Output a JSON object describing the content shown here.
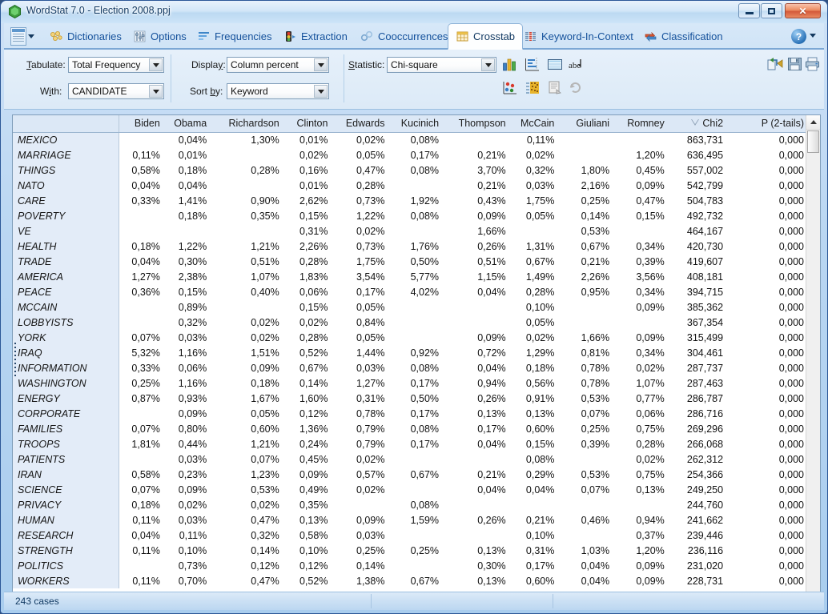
{
  "window": {
    "title": "WordStat 7.0 - Election 2008.ppj",
    "app_icon": "wordstat-logo-icon",
    "controls": {
      "minimize": "minimize-button",
      "maximize": "maximize-button",
      "close": "close-button",
      "close_glyph": "✕"
    }
  },
  "ribbon": {
    "app_menu_label": "application-menu",
    "tabs": [
      {
        "label": "Dictionaries",
        "icon": "dictionaries-icon",
        "active": false
      },
      {
        "label": "Options",
        "icon": "options-icon",
        "active": false
      },
      {
        "label": "Frequencies",
        "icon": "frequencies-icon",
        "active": false
      },
      {
        "label": "Extraction",
        "icon": "extraction-icon",
        "active": false
      },
      {
        "label": "Cooccurrences",
        "icon": "cooccurrences-icon",
        "active": false
      },
      {
        "label": "Crosstab",
        "icon": "crosstab-icon",
        "active": true
      },
      {
        "label": "Keyword-In-Context",
        "icon": "keyword-in-context-icon",
        "active": false
      },
      {
        "label": "Classification",
        "icon": "classification-icon",
        "active": false
      }
    ],
    "help_glyph": "?"
  },
  "options": {
    "tabulate": {
      "label": "Tabulate:",
      "accel": "T",
      "value": "Total Frequency"
    },
    "with": {
      "label": "With:",
      "accel": "i",
      "value": "CANDIDATE"
    },
    "display": {
      "label": "Display:",
      "accel": "y",
      "value": "Column percent"
    },
    "sort_by": {
      "label": "Sort by:",
      "accel": "b",
      "value": "Keyword"
    },
    "statistic": {
      "label": "Statistic:",
      "accel": "S",
      "value": "Chi-square"
    },
    "tool_icons": [
      "bar-chart-icon",
      "dendrogram-icon",
      "table-view-icon",
      "text-sort-icon",
      "scatterplot-icon",
      "heatmap-icon",
      "report-icon",
      "refresh-icon"
    ],
    "right_icons": [
      "export-icon",
      "save-icon",
      "print-icon"
    ]
  },
  "grid": {
    "sort_column": "Romney",
    "sort_indicator": "descending-sort-icon",
    "columns": [
      "",
      "Biden",
      "Obama",
      "Richardson",
      "Clinton",
      "Edwards",
      "Kucinich",
      "Thompson",
      "McCain",
      "Giuliani",
      "Romney",
      "Chi2",
      "P (2-tails)"
    ],
    "rows": [
      {
        "keyword": "MEXICO",
        "values": [
          "",
          "0,04%",
          "1,30%",
          "0,01%",
          "0,02%",
          "0,08%",
          "",
          "0,11%",
          "",
          "",
          "863,731",
          "0,000"
        ],
        "selected": false
      },
      {
        "keyword": "MARRIAGE",
        "values": [
          "0,11%",
          "0,01%",
          "",
          "0,02%",
          "0,05%",
          "0,17%",
          "0,21%",
          "0,02%",
          "",
          "1,20%",
          "636,495",
          "0,000"
        ],
        "selected": false
      },
      {
        "keyword": "THINGS",
        "values": [
          "0,58%",
          "0,18%",
          "0,28%",
          "0,16%",
          "0,47%",
          "0,08%",
          "3,70%",
          "0,32%",
          "1,80%",
          "0,45%",
          "557,002",
          "0,000"
        ],
        "selected": false
      },
      {
        "keyword": "NATO",
        "values": [
          "0,04%",
          "0,04%",
          "",
          "0,01%",
          "0,28%",
          "",
          "0,21%",
          "0,03%",
          "2,16%",
          "0,09%",
          "542,799",
          "0,000"
        ],
        "selected": false
      },
      {
        "keyword": "CARE",
        "values": [
          "0,33%",
          "1,41%",
          "0,90%",
          "2,62%",
          "0,73%",
          "1,92%",
          "0,43%",
          "1,75%",
          "0,25%",
          "0,47%",
          "504,783",
          "0,000"
        ],
        "selected": false
      },
      {
        "keyword": "POVERTY",
        "values": [
          "",
          "0,18%",
          "0,35%",
          "0,15%",
          "1,22%",
          "0,08%",
          "0,09%",
          "0,05%",
          "0,14%",
          "0,15%",
          "492,732",
          "0,000"
        ],
        "selected": true
      },
      {
        "keyword": "VE",
        "values": [
          "",
          "",
          "",
          "0,31%",
          "0,02%",
          "",
          "1,66%",
          "",
          "0,53%",
          "",
          "464,167",
          "0,000"
        ],
        "selected": false
      },
      {
        "keyword": "HEALTH",
        "values": [
          "0,18%",
          "1,22%",
          "1,21%",
          "2,26%",
          "0,73%",
          "1,76%",
          "0,26%",
          "1,31%",
          "0,67%",
          "0,34%",
          "420,730",
          "0,000"
        ],
        "selected": false
      },
      {
        "keyword": "TRADE",
        "values": [
          "0,04%",
          "0,30%",
          "0,51%",
          "0,28%",
          "1,75%",
          "0,50%",
          "0,51%",
          "0,67%",
          "0,21%",
          "0,39%",
          "419,607",
          "0,000"
        ],
        "selected": false
      },
      {
        "keyword": "AMERICA",
        "values": [
          "1,27%",
          "2,38%",
          "1,07%",
          "1,83%",
          "3,54%",
          "5,77%",
          "1,15%",
          "1,49%",
          "2,26%",
          "3,56%",
          "408,181",
          "0,000"
        ],
        "selected": false
      },
      {
        "keyword": "PEACE",
        "values": [
          "0,36%",
          "0,15%",
          "0,40%",
          "0,06%",
          "0,17%",
          "4,02%",
          "0,04%",
          "0,28%",
          "0,95%",
          "0,34%",
          "394,715",
          "0,000"
        ],
        "selected": false
      },
      {
        "keyword": "MCCAIN",
        "values": [
          "",
          "0,89%",
          "",
          "0,15%",
          "0,05%",
          "",
          "",
          "0,10%",
          "",
          "0,09%",
          "385,362",
          "0,000"
        ],
        "selected": false
      },
      {
        "keyword": "LOBBYISTS",
        "values": [
          "",
          "0,32%",
          "0,02%",
          "0,02%",
          "0,84%",
          "",
          "",
          "0,05%",
          "",
          "",
          "367,354",
          "0,000"
        ],
        "selected": false
      },
      {
        "keyword": "YORK",
        "values": [
          "0,07%",
          "0,03%",
          "0,02%",
          "0,28%",
          "0,05%",
          "",
          "0,09%",
          "0,02%",
          "1,66%",
          "0,09%",
          "315,499",
          "0,000"
        ],
        "selected": false
      },
      {
        "keyword": "IRAQ",
        "values": [
          "5,32%",
          "1,16%",
          "1,51%",
          "0,52%",
          "1,44%",
          "0,92%",
          "0,72%",
          "1,29%",
          "0,81%",
          "0,34%",
          "304,461",
          "0,000"
        ],
        "selected": false
      },
      {
        "keyword": "INFORMATION",
        "values": [
          "0,33%",
          "0,06%",
          "0,09%",
          "0,67%",
          "0,03%",
          "0,08%",
          "0,04%",
          "0,18%",
          "0,78%",
          "0,02%",
          "287,737",
          "0,000"
        ],
        "selected": false
      },
      {
        "keyword": "WASHINGTON",
        "values": [
          "0,25%",
          "1,16%",
          "0,18%",
          "0,14%",
          "1,27%",
          "0,17%",
          "0,94%",
          "0,56%",
          "0,78%",
          "1,07%",
          "287,463",
          "0,000"
        ],
        "selected": false
      },
      {
        "keyword": "ENERGY",
        "values": [
          "0,87%",
          "0,93%",
          "1,67%",
          "1,60%",
          "0,31%",
          "0,50%",
          "0,26%",
          "0,91%",
          "0,53%",
          "0,77%",
          "286,787",
          "0,000"
        ],
        "selected": false
      },
      {
        "keyword": "CORPORATE",
        "values": [
          "",
          "0,09%",
          "0,05%",
          "0,12%",
          "0,78%",
          "0,17%",
          "0,13%",
          "0,13%",
          "0,07%",
          "0,06%",
          "286,716",
          "0,000"
        ],
        "selected": false
      },
      {
        "keyword": "FAMILIES",
        "values": [
          "0,07%",
          "0,80%",
          "0,60%",
          "1,36%",
          "0,79%",
          "0,08%",
          "0,17%",
          "0,60%",
          "0,25%",
          "0,75%",
          "269,296",
          "0,000"
        ],
        "selected": false
      },
      {
        "keyword": "TROOPS",
        "values": [
          "1,81%",
          "0,44%",
          "1,21%",
          "0,24%",
          "0,79%",
          "0,17%",
          "0,04%",
          "0,15%",
          "0,39%",
          "0,28%",
          "266,068",
          "0,000"
        ],
        "selected": false
      },
      {
        "keyword": "PATIENTS",
        "values": [
          "",
          "0,03%",
          "0,07%",
          "0,45%",
          "0,02%",
          "",
          "",
          "0,08%",
          "",
          "0,02%",
          "262,312",
          "0,000"
        ],
        "selected": false
      },
      {
        "keyword": "IRAN",
        "values": [
          "0,58%",
          "0,23%",
          "1,23%",
          "0,09%",
          "0,57%",
          "0,67%",
          "0,21%",
          "0,29%",
          "0,53%",
          "0,75%",
          "254,366",
          "0,000"
        ],
        "selected": false
      },
      {
        "keyword": "SCIENCE",
        "values": [
          "0,07%",
          "0,09%",
          "0,53%",
          "0,49%",
          "0,02%",
          "",
          "0,04%",
          "0,04%",
          "0,07%",
          "0,13%",
          "249,250",
          "0,000"
        ],
        "selected": false
      },
      {
        "keyword": "PRIVACY",
        "values": [
          "0,18%",
          "0,02%",
          "0,02%",
          "0,35%",
          "",
          "0,08%",
          "",
          "",
          "",
          "",
          "244,760",
          "0,000"
        ],
        "selected": false
      },
      {
        "keyword": "HUMAN",
        "values": [
          "0,11%",
          "0,03%",
          "0,47%",
          "0,13%",
          "0,09%",
          "1,59%",
          "0,26%",
          "0,21%",
          "0,46%",
          "0,94%",
          "241,662",
          "0,000"
        ],
        "selected": false
      },
      {
        "keyword": "RESEARCH",
        "values": [
          "0,04%",
          "0,11%",
          "0,32%",
          "0,58%",
          "0,03%",
          "",
          "",
          "0,10%",
          "",
          "0,37%",
          "239,446",
          "0,000"
        ],
        "selected": false
      },
      {
        "keyword": "STRENGTH",
        "values": [
          "0,11%",
          "0,10%",
          "0,14%",
          "0,10%",
          "0,25%",
          "0,25%",
          "0,13%",
          "0,31%",
          "1,03%",
          "1,20%",
          "236,116",
          "0,000"
        ],
        "selected": false
      },
      {
        "keyword": "POLITICS",
        "values": [
          "",
          "0,73%",
          "0,12%",
          "0,12%",
          "0,14%",
          "",
          "0,30%",
          "0,17%",
          "0,04%",
          "0,09%",
          "231,020",
          "0,000"
        ],
        "selected": false
      },
      {
        "keyword": "WORKERS",
        "values": [
          "0,11%",
          "0,70%",
          "0,47%",
          "0,52%",
          "1,38%",
          "0,67%",
          "0,13%",
          "0,60%",
          "0,04%",
          "0,09%",
          "228,731",
          "0,000"
        ],
        "selected": false
      }
    ]
  },
  "statusbar": {
    "cases": "243 cases"
  }
}
